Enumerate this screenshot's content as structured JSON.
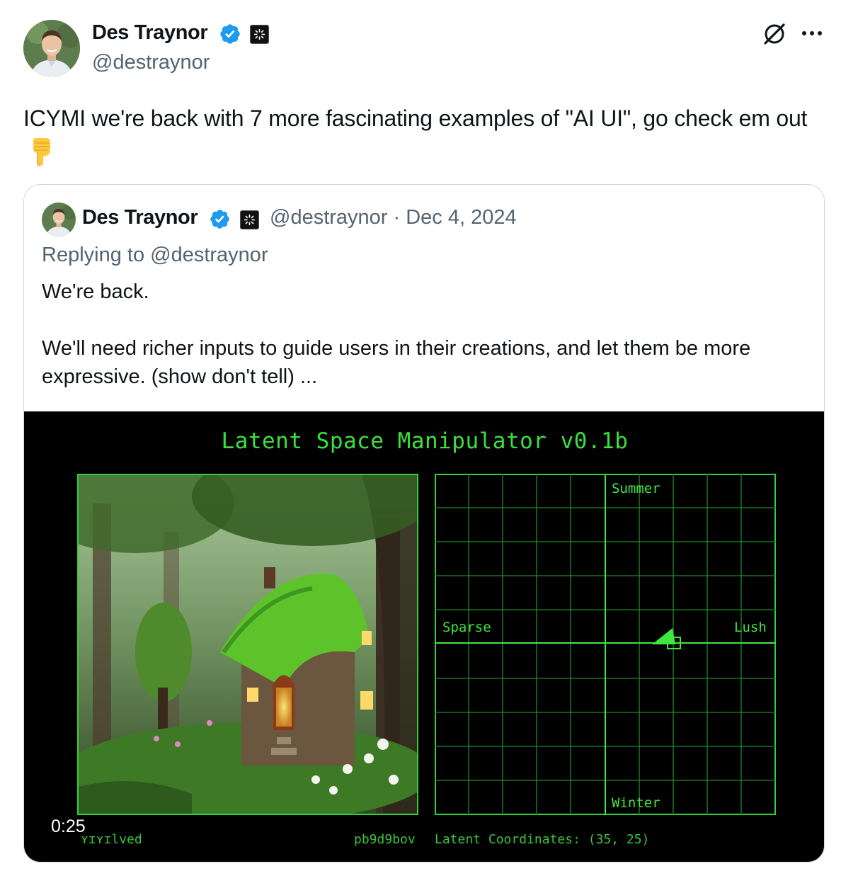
{
  "tweet": {
    "author_name": "Des Traynor",
    "author_handle": "@destraynor",
    "text": "ICYMI we're back with 7 more fascinating examples of \"AI UI\", go check em out",
    "emoji": "backhand-index-pointing-down"
  },
  "quoted_tweet": {
    "author_name": "Des Traynor",
    "author_handle": "@destraynor",
    "separator": "·",
    "date": "Dec 4, 2024",
    "meta_line": "@destraynor · Dec 4, 2024",
    "replying_to": "Replying to @destraynor",
    "text": "We're back.\n\nWe'll need richer inputs to guide users in their creations, and let them be more expressive.  (show don't tell) ..."
  },
  "media": {
    "app_title": "Latent Space Manipulator v0.1b",
    "axis_labels": {
      "top": "Summer",
      "bottom": "Winter",
      "left": "Sparse",
      "right": "Lush"
    },
    "status_left": "ʏɪʏɪlved",
    "status_mid": "pb9d9bov",
    "status_coords": "Latent Coordinates: (35, 25)",
    "duration": "0:25"
  },
  "colors": {
    "verified_blue": "#1d9bf0",
    "terminal_green": "#39e03f",
    "muted_text": "#536471"
  },
  "icons": [
    "verified-badge-icon",
    "affiliation-badge-icon",
    "grok-icon",
    "more-options-icon",
    "pointing-down-emoji"
  ]
}
